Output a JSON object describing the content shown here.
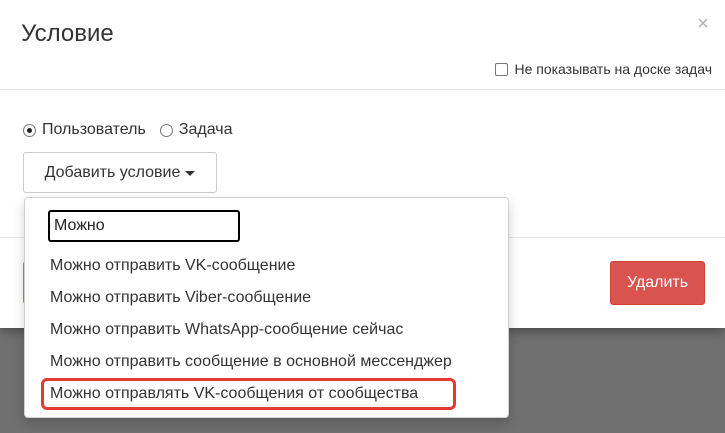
{
  "modal": {
    "title": "Условие",
    "close_symbol": "×",
    "hide_checkbox_label": "Не показывать на доске задач"
  },
  "radios": [
    {
      "label": "Пользователь",
      "checked": true
    },
    {
      "label": "Задача",
      "checked": false
    }
  ],
  "add_condition_label": "Добавить условие",
  "dropdown": {
    "search_value": "Можно",
    "items": [
      "Можно отправить VK-сообщение",
      "Можно отправить Viber-сообщение",
      "Можно отправить WhatsApp-сообщение сейчас",
      "Можно отправить сообщение в основной мессенджер",
      "Можно отправлять VK-сообщения от сообщества"
    ],
    "highlighted_index": 4
  },
  "footer": {
    "delete_label": "Удалить"
  },
  "colors": {
    "delete": "#d9534f",
    "success": "#5cb85c",
    "highlight": "#e53935"
  }
}
